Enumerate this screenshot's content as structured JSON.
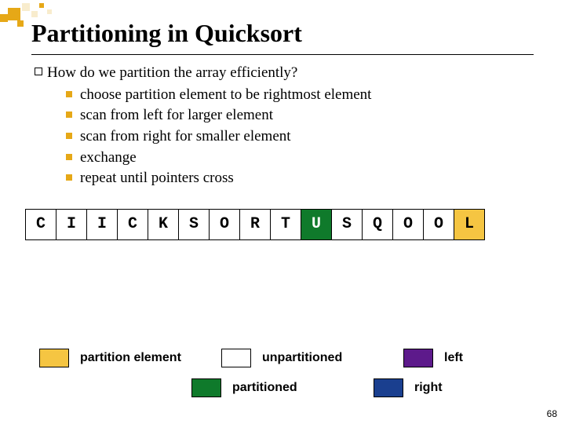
{
  "title": "Partitioning in Quicksort",
  "question": "How do we partition the array efficiently?",
  "steps": [
    "choose partition element to be rightmost element",
    "scan from left for larger element",
    "scan from right for smaller element",
    "exchange",
    "repeat until pointers cross"
  ],
  "array": [
    {
      "v": "C",
      "c": "c-white"
    },
    {
      "v": "I",
      "c": "c-white"
    },
    {
      "v": "I",
      "c": "c-white"
    },
    {
      "v": "C",
      "c": "c-white"
    },
    {
      "v": "K",
      "c": "c-white"
    },
    {
      "v": "S",
      "c": "c-white"
    },
    {
      "v": "O",
      "c": "c-white"
    },
    {
      "v": "R",
      "c": "c-white"
    },
    {
      "v": "T",
      "c": "c-white"
    },
    {
      "v": "U",
      "c": "c-green"
    },
    {
      "v": "S",
      "c": "c-white"
    },
    {
      "v": "Q",
      "c": "c-white"
    },
    {
      "v": "O",
      "c": "c-white"
    },
    {
      "v": "O",
      "c": "c-white"
    },
    {
      "v": "L",
      "c": "c-yellow"
    }
  ],
  "legend": {
    "partition_element": "partition element",
    "unpartitioned": "unpartitioned",
    "left": "left",
    "partitioned": "partitioned",
    "right": "right"
  },
  "page_number": "68",
  "colors": {
    "yellow": "#f5c542",
    "green": "#0f7a2b",
    "purple": "#5d1a8b",
    "blue": "#1a3f8f",
    "white": "#ffffff"
  }
}
